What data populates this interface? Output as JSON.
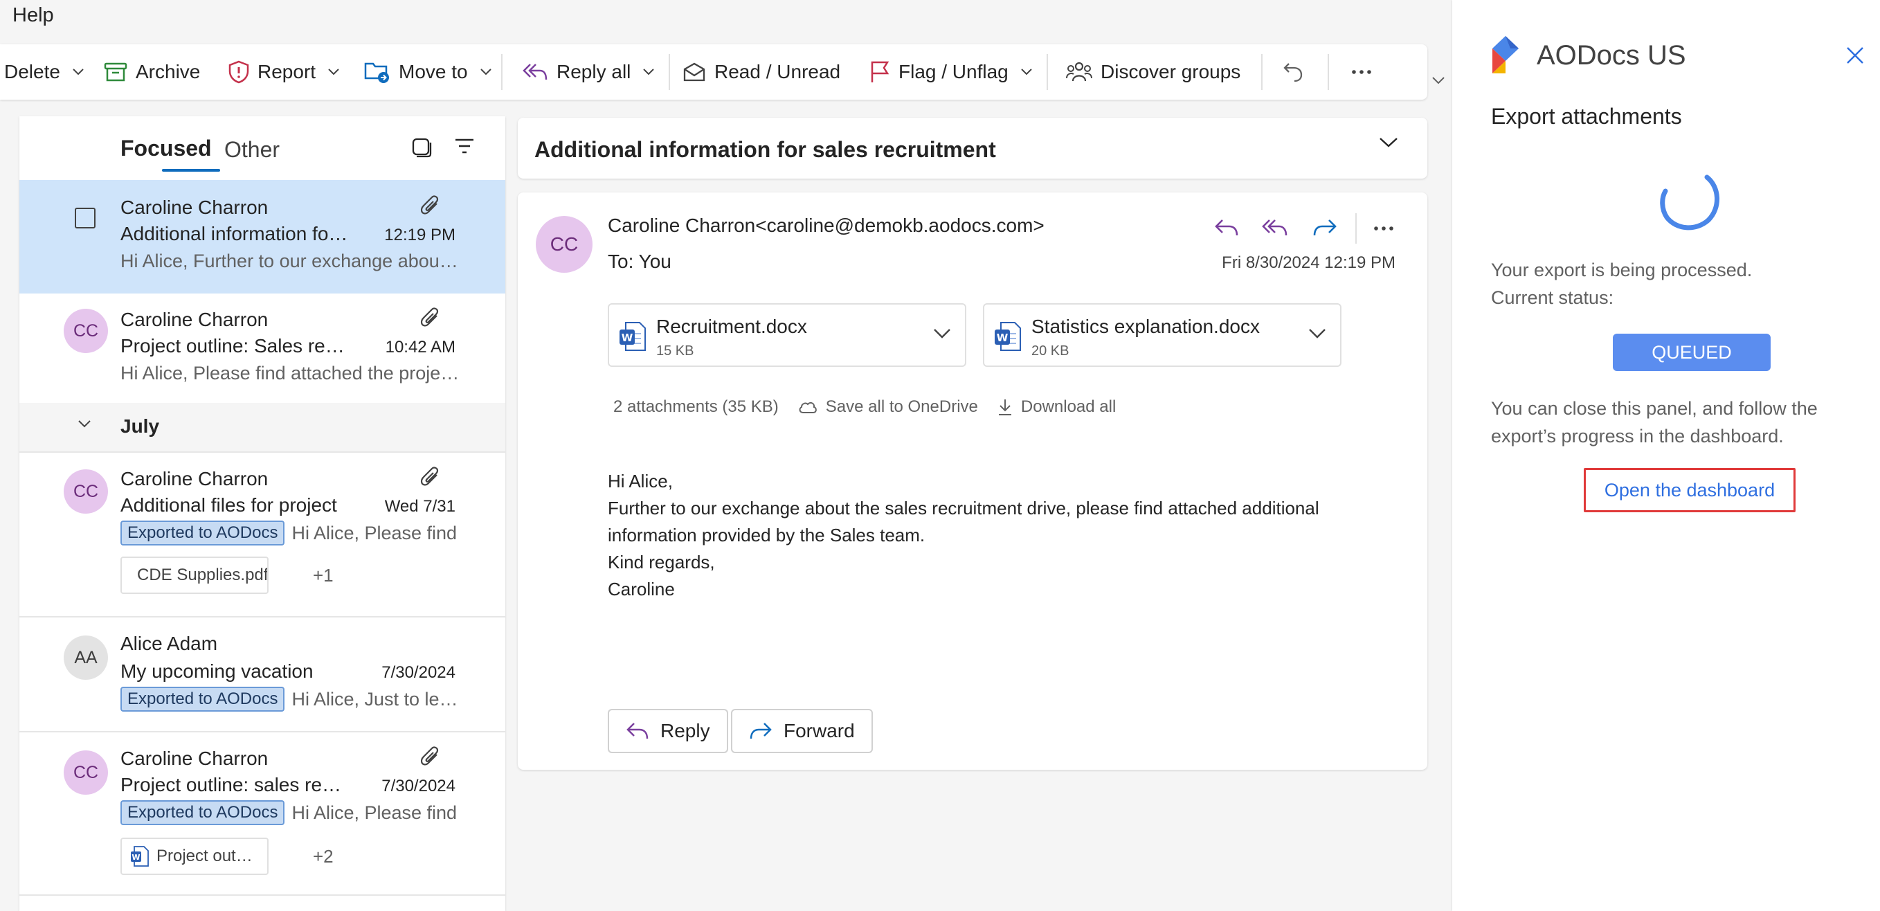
{
  "menu": {
    "help": "Help"
  },
  "ribbon": {
    "delete": "Delete",
    "archive": "Archive",
    "report": "Report",
    "move_to": "Move to",
    "reply_all": "Reply all",
    "read_unread": "Read / Unread",
    "flag_unflag": "Flag / Unflag",
    "discover_groups": "Discover groups"
  },
  "message_list": {
    "tabs": {
      "focused": "Focused",
      "other": "Other"
    },
    "items": [
      {
        "sender": "Caroline Charron",
        "subject": "Additional information for sales recruitment",
        "time": "12:19 PM",
        "preview": "Hi Alice, Further to our exchange about the sales recruitment drive",
        "selected": true,
        "has_attachment": true
      },
      {
        "sender": "Caroline Charron",
        "initials": "CC",
        "subject": "Project outline: Sales recruitment",
        "time": "10:42 AM",
        "preview": "Hi Alice, Please find attached the project outline",
        "has_attachment": true
      }
    ],
    "group_label": "July",
    "july_items": [
      {
        "sender": "Caroline Charron",
        "initials": "CC",
        "subject": "Additional files for project",
        "time": "Wed 7/31",
        "tag": "Exported to AODocs",
        "preview": "Hi Alice, Please find",
        "has_attachment": true,
        "chip": "CDE Supplies.pdf",
        "more": "+1"
      },
      {
        "sender": "Alice Adam",
        "initials": "AA",
        "subject": "My upcoming vacation",
        "time": "7/30/2024",
        "tag": "Exported to AODocs",
        "preview": "Hi Alice, Just to let you know"
      },
      {
        "sender": "Caroline Charron",
        "initials": "CC",
        "subject": "Project outline: sales recruitment",
        "time": "7/30/2024",
        "tag": "Exported to AODocs",
        "preview": "Hi Alice, Please find",
        "has_attachment": true,
        "chip": "Project outline.docx",
        "more": "+2"
      }
    ]
  },
  "reading_pane": {
    "subject": "Additional information for sales recruitment",
    "from_initials": "CC",
    "from": "Caroline Charron<caroline@demokb.aodocs.com>",
    "to": "To:  You",
    "date": "Fri 8/30/2024 12:19 PM",
    "attachments": [
      {
        "name": "Recruitment.docx",
        "size": "15 KB"
      },
      {
        "name": "Statistics explanation.docx",
        "size": "20 KB"
      }
    ],
    "attachments_summary": "2 attachments (35 KB)",
    "save_all": "Save all to OneDrive",
    "download_all": "Download all",
    "body": [
      "Hi Alice,",
      "Further to our exchange about the sales recruitment drive, please find attached additional",
      "information provided by the Sales team.",
      "Kind regards,",
      "Caroline"
    ],
    "reply": "Reply",
    "forward": "Forward"
  },
  "aodocs_panel": {
    "title": "AODocs US",
    "heading": "Export attachments",
    "processing": "Your export is being processed.",
    "current_status_label": "Current status:",
    "status": "QUEUED",
    "info": "You can close this panel, and follow the export’s progress in the dashboard.",
    "open_dashboard": "Open the dashboard"
  },
  "colors": {
    "accent": "#0f6cbd",
    "selected_row": "#cfe4fa",
    "avatar_cc": "#e6c6ed",
    "tag_bg": "#c7dbf3",
    "status_bg": "#5b8def",
    "dashboard_border": "#e03a3a",
    "dashboard_text": "#2f6fe0"
  },
  "icons": [
    "trash",
    "archive-icon",
    "shield-icon",
    "folder-move-icon",
    "reply-all-icon",
    "envelope-icon",
    "flag-icon",
    "people-icon",
    "undo-icon",
    "more-icon",
    "paperclip-icon",
    "word-doc-icon",
    "pdf-icon",
    "cloud-icon",
    "download-icon",
    "reply-icon",
    "forward-icon",
    "spinner-icon",
    "close-icon",
    "aodocs-logo"
  ]
}
